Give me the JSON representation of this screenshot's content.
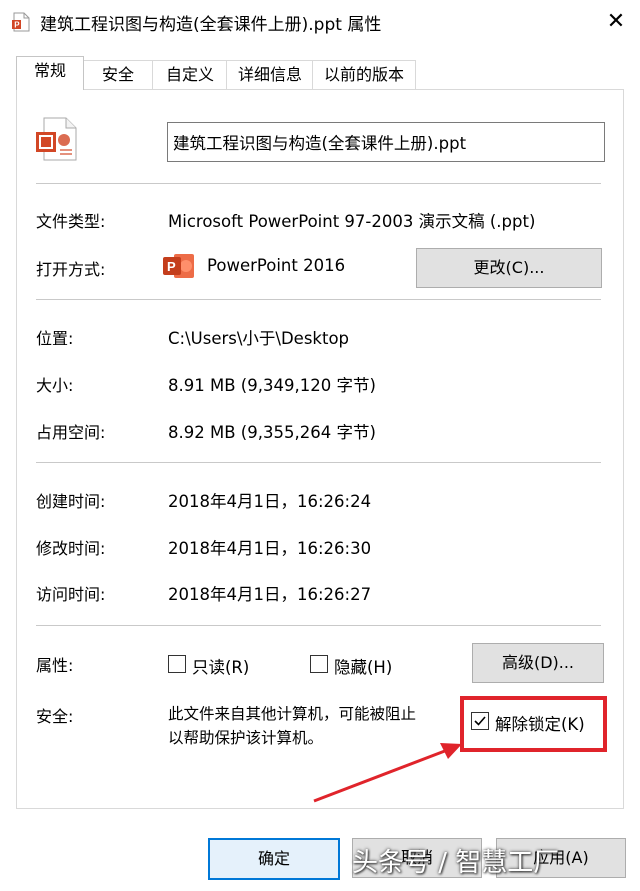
{
  "window": {
    "title": "建筑工程识图与构造(全套课件上册).ppt 属性",
    "close_glyph": "✕"
  },
  "tabs": [
    {
      "label": "常规",
      "active": true
    },
    {
      "label": "安全",
      "active": false
    },
    {
      "label": "自定义",
      "active": false
    },
    {
      "label": "详细信息",
      "active": false
    },
    {
      "label": "以前的版本",
      "active": false
    }
  ],
  "general": {
    "file_name": "建筑工程识图与构造(全套课件上册).ppt",
    "file_type_label": "文件类型:",
    "file_type_value": "Microsoft PowerPoint 97-2003 演示文稿 (.ppt)",
    "open_with_label": "打开方式:",
    "open_with_value": "PowerPoint 2016",
    "change_button": "更改(C)...",
    "location_label": "位置:",
    "location_value": "C:\\Users\\小于\\Desktop",
    "size_label": "大小:",
    "size_value": "8.91 MB (9,349,120 字节)",
    "disk_size_label": "占用空间:",
    "disk_size_value": "8.92 MB (9,355,264 字节)",
    "created_label": "创建时间:",
    "created_value": "2018年4月1日，16:26:24",
    "modified_label": "修改时间:",
    "modified_value": "2018年4月1日，16:26:30",
    "accessed_label": "访问时间:",
    "accessed_value": "2018年4月1日，16:26:27",
    "attributes_label": "属性:",
    "readonly_label": "只读(R)",
    "readonly_checked": false,
    "hidden_label": "隐藏(H)",
    "hidden_checked": false,
    "advanced_button": "高级(D)...",
    "security_label": "安全:",
    "security_text_line1": "此文件来自其他计算机，可能被阻止",
    "security_text_line2": "以帮助保护该计算机。",
    "unblock_label": "解除锁定(K)",
    "unblock_checked": true
  },
  "footer": {
    "ok_button": "确定",
    "cancel_button": "取消",
    "apply_button": "应用(A)"
  },
  "watermark": "头条号 / 智慧工厂",
  "colors": {
    "highlight_red": "#e0242b",
    "ppt_orange": "#d24726"
  }
}
